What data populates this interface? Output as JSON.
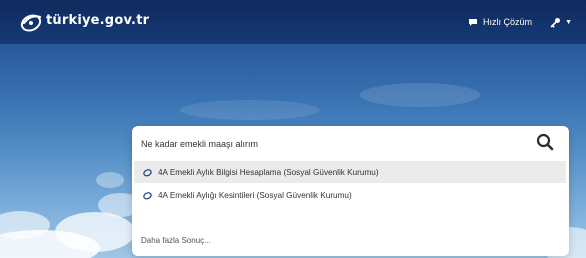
{
  "header": {
    "logo_text": "türkiye.gov.tr",
    "quick_solution_label": "Hızlı Çözüm"
  },
  "search": {
    "value": "Ne kadar emekli maaşı alırım",
    "results": [
      {
        "label": "4A Emekli Aylık Bilgisi Hesaplama (Sosyal Güvenlik Kurumu)"
      },
      {
        "label": "4A Emekli Aylığı Kesintileri (Sosyal Güvenlik Kurumu)"
      }
    ],
    "more_label": "Daha fazla Sonuç..."
  },
  "colors": {
    "header_bg": "#163a76",
    "accent": "#1b3f7e",
    "sky_bottom": "#9fc6e6"
  },
  "icons": [
    "edevlet-logo-icon",
    "chat-icon",
    "key-icon",
    "chevron-down-icon",
    "search-icon",
    "edevlet-small-icon"
  ]
}
